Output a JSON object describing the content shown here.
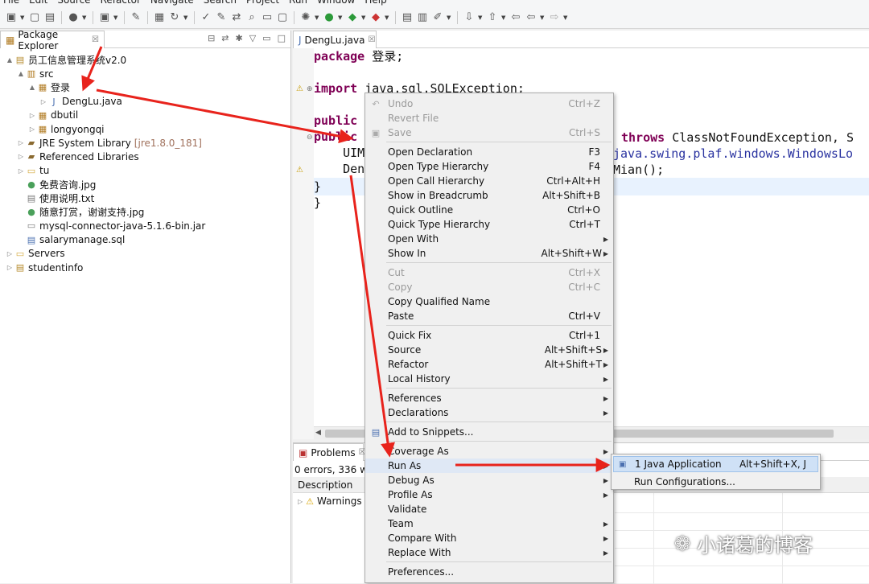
{
  "menubar": [
    "File",
    "Edit",
    "Source",
    "Refactor",
    "Navigate",
    "Search",
    "Project",
    "Run",
    "Window",
    "Help"
  ],
  "explorer": {
    "tab_label": "Package Explorer",
    "tree": [
      {
        "label": "员工信息管理系统v2.0",
        "icon": "project-icon",
        "twisty": "▲",
        "indent": 0
      },
      {
        "label": "src",
        "icon": "source-folder-icon",
        "twisty": "▲",
        "indent": 1
      },
      {
        "label": "登录",
        "icon": "package-icon",
        "twisty": "▲",
        "indent": 2
      },
      {
        "label": "DengLu.java",
        "icon": "java-file-icon",
        "twisty": "▷",
        "indent": 3
      },
      {
        "label": "dbutil",
        "icon": "package-icon",
        "twisty": "▷",
        "indent": 2
      },
      {
        "label": "longyongqi",
        "icon": "package-icon",
        "twisty": "▷",
        "indent": 2
      },
      {
        "label": "JRE System Library",
        "extra": "[jre1.8.0_181]",
        "icon": "library-icon",
        "twisty": "▷",
        "indent": 1
      },
      {
        "label": "Referenced Libraries",
        "icon": "library-icon",
        "twisty": "▷",
        "indent": 1
      },
      {
        "label": "tu",
        "icon": "folder-icon",
        "twisty": "▷",
        "indent": 1
      },
      {
        "label": "免费咨询.jpg",
        "icon": "image-icon",
        "twisty": "",
        "indent": 1
      },
      {
        "label": "使用说明.txt",
        "icon": "text-file-icon",
        "twisty": "",
        "indent": 1
      },
      {
        "label": "随意打赏，谢谢支持.jpg",
        "icon": "image-icon",
        "twisty": "",
        "indent": 1
      },
      {
        "label": "mysql-connector-java-5.1.6-bin.jar",
        "icon": "jar-icon",
        "twisty": "",
        "indent": 1
      },
      {
        "label": "salarymanage.sql",
        "icon": "sql-file-icon",
        "twisty": "",
        "indent": 1
      },
      {
        "label": "Servers",
        "icon": "folder-icon",
        "twisty": "▷",
        "indent": 0
      },
      {
        "label": "studentinfo",
        "icon": "project-icon",
        "twisty": "▷",
        "indent": 0
      }
    ]
  },
  "editor": {
    "tab_label": "DengLu.java",
    "lines": [
      {
        "kw": "package",
        "rest": " 登录;"
      },
      {
        "kw": "",
        "rest": ""
      },
      {
        "kw": "import",
        "rest": " java.sql.SQLException;"
      },
      {
        "kw": "",
        "rest": ""
      },
      {
        "kw": "public",
        "rest": ""
      },
      {
        "kw": "public",
        "rest": ""
      },
      {
        "kw": "",
        "rest": "    UIM"
      },
      {
        "kw": "",
        "rest": "    Den"
      },
      {
        "kw": "",
        "rest": "}"
      },
      {
        "kw": "",
        "rest": "}"
      }
    ],
    "right_fragments": {
      "line5_kw": "throws",
      "line5_rest": " ClassNotFoundException, S",
      "line6_cls": "java.swing.plaf.windows.WindowsLo",
      "line7": "Mian();"
    }
  },
  "problems": {
    "tab_label": "Problems",
    "summary": "0 errors, 336 wa",
    "column": "Description",
    "row": "Warnings"
  },
  "context_menu": {
    "items": [
      {
        "label": "Undo",
        "key": "Ctrl+Z",
        "disabled": true,
        "icon": "undo-icon"
      },
      {
        "label": "Revert File",
        "key": "",
        "disabled": true
      },
      {
        "label": "Save",
        "key": "Ctrl+S",
        "disabled": true,
        "icon": "save-icon"
      },
      {
        "sep": true
      },
      {
        "label": "Open Declaration",
        "key": "F3"
      },
      {
        "label": "Open Type Hierarchy",
        "key": "F4"
      },
      {
        "label": "Open Call Hierarchy",
        "key": "Ctrl+Alt+H"
      },
      {
        "label": "Show in Breadcrumb",
        "key": "Alt+Shift+B"
      },
      {
        "label": "Quick Outline",
        "key": "Ctrl+O"
      },
      {
        "label": "Quick Type Hierarchy",
        "key": "Ctrl+T"
      },
      {
        "label": "Open With",
        "key": "",
        "submenu": true
      },
      {
        "label": "Show In",
        "key": "Alt+Shift+W",
        "submenu": true
      },
      {
        "sep": true
      },
      {
        "label": "Cut",
        "key": "Ctrl+X",
        "disabled": true
      },
      {
        "label": "Copy",
        "key": "Ctrl+C",
        "disabled": true
      },
      {
        "label": "Copy Qualified Name",
        "key": ""
      },
      {
        "label": "Paste",
        "key": "Ctrl+V"
      },
      {
        "sep": true
      },
      {
        "label": "Quick Fix",
        "key": "Ctrl+1"
      },
      {
        "label": "Source",
        "key": "Alt+Shift+S",
        "submenu": true
      },
      {
        "label": "Refactor",
        "key": "Alt+Shift+T",
        "submenu": true
      },
      {
        "label": "Local History",
        "key": "",
        "submenu": true
      },
      {
        "sep": true
      },
      {
        "label": "References",
        "key": "",
        "submenu": true
      },
      {
        "label": "Declarations",
        "key": "",
        "submenu": true
      },
      {
        "sep": true
      },
      {
        "label": "Add to Snippets...",
        "key": "",
        "icon": "snippet-icon"
      },
      {
        "sep": true
      },
      {
        "label": "Coverage As",
        "key": "",
        "submenu": true
      },
      {
        "label": "Run As",
        "key": "",
        "submenu": true,
        "active": true
      },
      {
        "label": "Debug As",
        "key": "",
        "submenu": true
      },
      {
        "label": "Profile As",
        "key": "",
        "submenu": true
      },
      {
        "label": "Validate",
        "key": ""
      },
      {
        "label": "Team",
        "key": "",
        "submenu": true
      },
      {
        "label": "Compare With",
        "key": "",
        "submenu": true
      },
      {
        "label": "Replace With",
        "key": "",
        "submenu": true
      },
      {
        "sep": true
      },
      {
        "label": "Preferences...",
        "key": ""
      }
    ]
  },
  "submenu": {
    "items": [
      {
        "label": "1 Java Application",
        "key": "Alt+Shift+X, J",
        "active": true
      },
      {
        "label": "Run Configurations...",
        "key": ""
      }
    ]
  },
  "watermark": "小诸葛的博客",
  "colors": {
    "keyword": "#7f0055",
    "arrow": "#e8231c",
    "selection": "#dfe8f5"
  }
}
